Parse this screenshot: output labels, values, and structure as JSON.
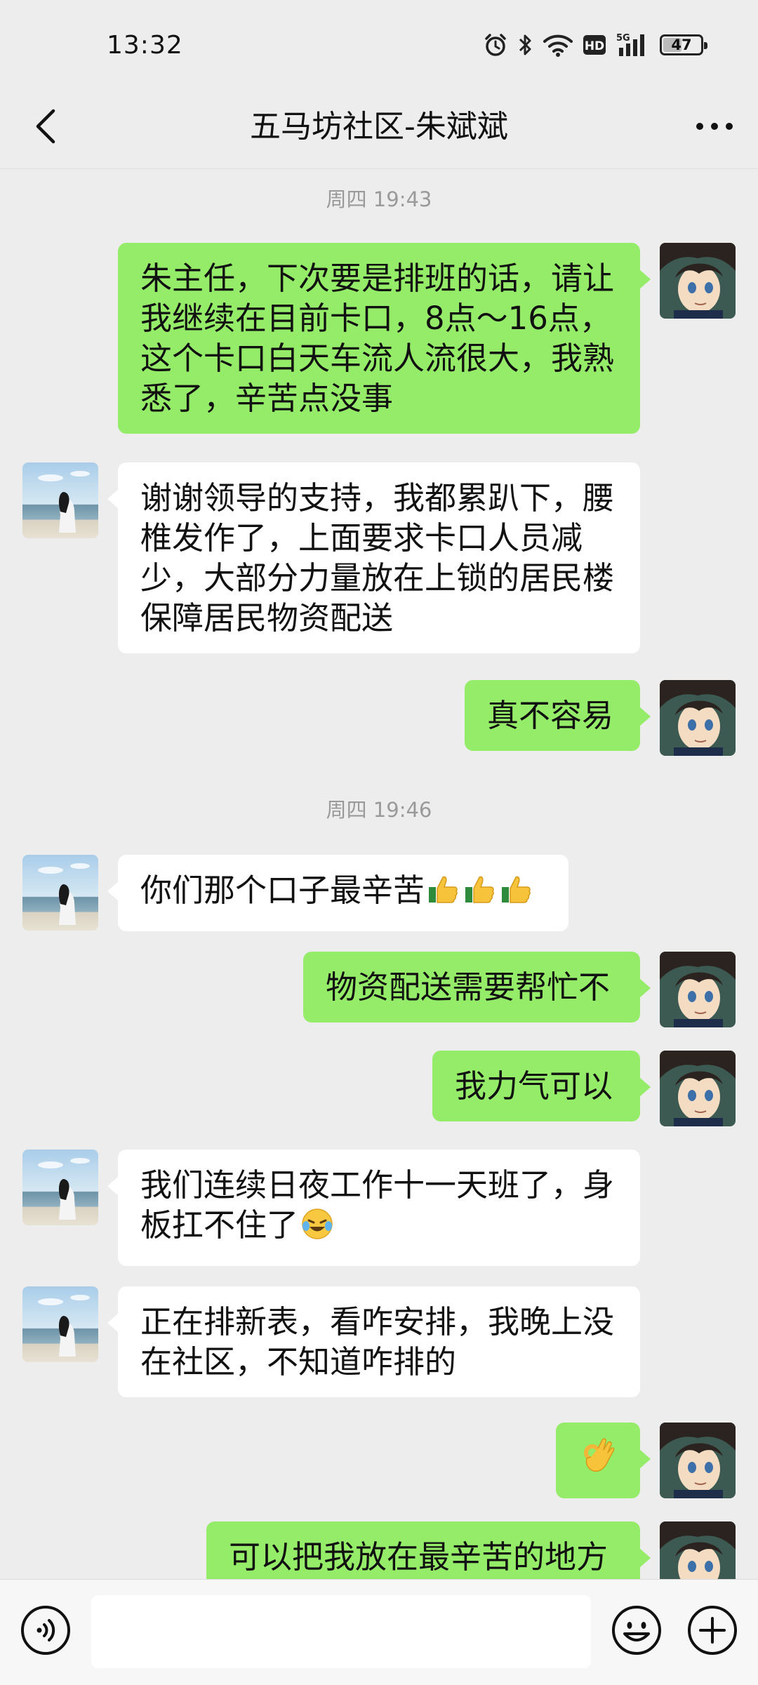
{
  "status_bar": {
    "time": "13:32",
    "battery": "47",
    "battery_level_percent": 47,
    "icons": [
      "alarm-icon",
      "bluetooth-icon",
      "wifi-icon",
      "hd-icon",
      "signal-5g-icon",
      "battery-icon"
    ]
  },
  "nav": {
    "title": "五马坊社区-朱斌斌",
    "back_icon": "chevron-left-icon",
    "more_icon": "more-horizontal-icon"
  },
  "chat": {
    "timestamps": [
      "周四 19:43",
      "周四 19:46"
    ],
    "messages": [
      {
        "side": "right",
        "text": "朱主任，下次要是排班的话，请让我继续在目前卡口，8点～16点，这个卡口白天车流人流很大，我熟悉了，辛苦点没事"
      },
      {
        "side": "left",
        "text": "谢谢领导的支持，我都累趴下，腰椎发作了，上面要求卡口人员减少，大部分力量放在上锁的居民楼保障居民物资配送"
      },
      {
        "side": "right",
        "text": "真不容易"
      },
      {
        "side": "left",
        "text": "你们那个口子最辛苦",
        "emoji": "thumbs-up-icon x3"
      },
      {
        "side": "right",
        "text": "物资配送需要帮忙不"
      },
      {
        "side": "right",
        "text": "我力气可以"
      },
      {
        "side": "left",
        "text": "我们连续日夜工作十一天班了，身板扛不住了",
        "emoji": "crying-laughing-icon"
      },
      {
        "side": "left",
        "text": "正在排新表，看咋安排，我晚上没在社区，不知道咋排的"
      },
      {
        "side": "right",
        "text": "",
        "emoji": "ok-hand-icon"
      },
      {
        "side": "right",
        "text": "可以把我放在最辛苦的地方"
      }
    ]
  },
  "input_bar": {
    "input_value": "",
    "voice_icon": "voice-icon",
    "emoji_icon": "emoji-icon",
    "plus_icon": "plus-icon"
  },
  "colors": {
    "background": "#ededed",
    "bubble_self": "#95ec69",
    "bubble_other": "#ffffff",
    "timestamp_text": "#9a9a9a"
  }
}
